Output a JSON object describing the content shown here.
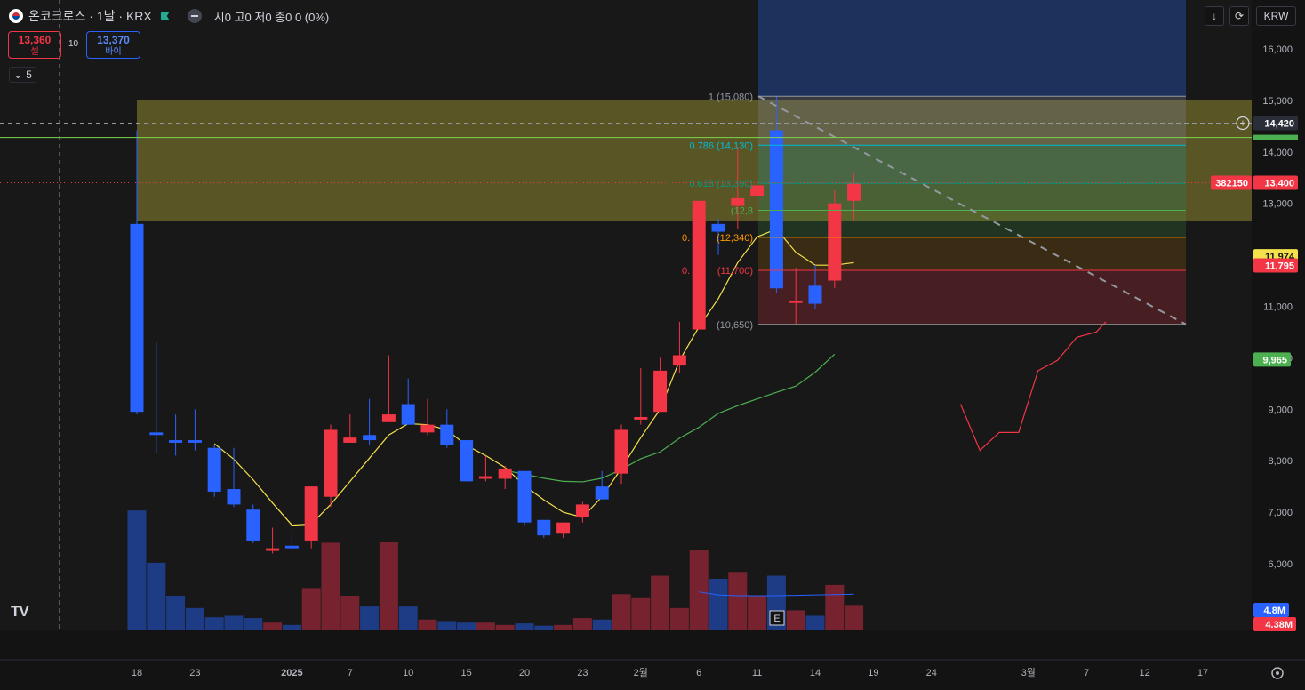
{
  "header": {
    "symbol_line": "온코크로스 · 1날 · KRX",
    "ohlc": "시0 고0 저0 종0 0 (0%)",
    "sell_price": "13,360",
    "sell_label": "셀",
    "buy_price": "13,370",
    "buy_label": "바이",
    "spread": "10",
    "interval_value": "5"
  },
  "toolbar": {
    "currency": "KRW",
    "download_icon": "arrow-down-icon",
    "refresh_icon": "refresh-icon"
  },
  "colors": {
    "up": "#f23645",
    "down": "#2962ff",
    "ma_fast": "#f5e14b",
    "ma_slow": "#4caf50",
    "zone": "#6f6a2a",
    "background": "#131313"
  },
  "chart_data": {
    "type": "candlestick",
    "y_range": [
      5200,
      17000
    ],
    "volume_range": [
      0,
      22000000
    ],
    "x_ticks": [
      "18",
      "23",
      "2025",
      "7",
      "10",
      "15",
      "20",
      "23",
      "2월",
      "6",
      "11",
      "14",
      "19",
      "24",
      "3월",
      "7",
      "12",
      "17"
    ],
    "y_ticks": [
      "16,000",
      "15,000",
      "14,000",
      "13,000",
      "12,000",
      "11,000",
      "10,000",
      "9,000",
      "8,000",
      "7,000",
      "6,000"
    ],
    "candles": [
      {
        "o": 12600,
        "h": 14420,
        "l": 8900,
        "c": 8950,
        "v": 15500000
      },
      {
        "o": 8550,
        "h": 10300,
        "l": 8150,
        "c": 8500,
        "v": 8700000
      },
      {
        "o": 8400,
        "h": 8900,
        "l": 8100,
        "c": 8350,
        "v": 4400000
      },
      {
        "o": 8400,
        "h": 9000,
        "l": 8200,
        "c": 8350,
        "v": 2800000
      },
      {
        "o": 8250,
        "h": 8300,
        "l": 7300,
        "c": 7400,
        "v": 1600000
      },
      {
        "o": 7450,
        "h": 8250,
        "l": 7100,
        "c": 7150,
        "v": 1800000
      },
      {
        "o": 7050,
        "h": 7150,
        "l": 6400,
        "c": 6450,
        "v": 1500000
      },
      {
        "o": 6250,
        "h": 6700,
        "l": 6200,
        "c": 6300,
        "v": 900000
      },
      {
        "o": 6350,
        "h": 6650,
        "l": 6250,
        "c": 6300,
        "v": 600000
      },
      {
        "o": 6450,
        "h": 7500,
        "l": 6300,
        "c": 7500,
        "v": 5400000
      },
      {
        "o": 7300,
        "h": 8700,
        "l": 7100,
        "c": 8600,
        "v": 11300000
      },
      {
        "o": 8350,
        "h": 8900,
        "l": 8350,
        "c": 8450,
        "v": 4400000
      },
      {
        "o": 8500,
        "h": 9200,
        "l": 8300,
        "c": 8400,
        "v": 3000000
      },
      {
        "o": 8750,
        "h": 10050,
        "l": 8750,
        "c": 8900,
        "v": 11400000
      },
      {
        "o": 9100,
        "h": 9600,
        "l": 8700,
        "c": 8700,
        "v": 3000000
      },
      {
        "o": 8550,
        "h": 9200,
        "l": 8500,
        "c": 8700,
        "v": 1300000
      },
      {
        "o": 8700,
        "h": 9000,
        "l": 8250,
        "c": 8300,
        "v": 1100000
      },
      {
        "o": 8400,
        "h": 8400,
        "l": 7600,
        "c": 7600,
        "v": 900000
      },
      {
        "o": 7650,
        "h": 8100,
        "l": 7600,
        "c": 7700,
        "v": 900000
      },
      {
        "o": 7650,
        "h": 7900,
        "l": 7450,
        "c": 7850,
        "v": 600000
      },
      {
        "o": 7800,
        "h": 7800,
        "l": 6750,
        "c": 6800,
        "v": 800000
      },
      {
        "o": 6850,
        "h": 6850,
        "l": 6500,
        "c": 6550,
        "v": 500000
      },
      {
        "o": 6600,
        "h": 6800,
        "l": 6500,
        "c": 6800,
        "v": 600000
      },
      {
        "o": 6900,
        "h": 7200,
        "l": 6800,
        "c": 7150,
        "v": 1500000
      },
      {
        "o": 7500,
        "h": 7800,
        "l": 7250,
        "c": 7250,
        "v": 1300000
      },
      {
        "o": 7750,
        "h": 8700,
        "l": 7550,
        "c": 8600,
        "v": 4600000
      },
      {
        "o": 8800,
        "h": 9800,
        "l": 8700,
        "c": 8850,
        "v": 4200000
      },
      {
        "o": 8950,
        "h": 10000,
        "l": 8950,
        "c": 9750,
        "v": 7000000
      },
      {
        "o": 9850,
        "h": 10700,
        "l": 9700,
        "c": 10050,
        "v": 2800000
      },
      {
        "o": 10550,
        "h": 13000,
        "l": 10550,
        "c": 13050,
        "v": 10400000
      },
      {
        "o": 12600,
        "h": 12700,
        "l": 12000,
        "c": 12450,
        "v": 6600000
      },
      {
        "o": 12950,
        "h": 14100,
        "l": 12500,
        "c": 13100,
        "v": 7500000
      },
      {
        "o": 13150,
        "h": 13400,
        "l": 12850,
        "c": 13350,
        "v": 4400000
      },
      {
        "o": 14420,
        "h": 15080,
        "l": 11250,
        "c": 11350,
        "v": 7000000
      },
      {
        "o": 11100,
        "h": 11750,
        "l": 10650,
        "c": 11100,
        "v": 2500000
      },
      {
        "o": 11400,
        "h": 11800,
        "l": 10950,
        "c": 11050,
        "v": 1800000
      },
      {
        "o": 11500,
        "h": 13250,
        "l": 11350,
        "c": 13000,
        "v": 5800000
      },
      {
        "o": 13050,
        "h": 13600,
        "l": 12650,
        "c": 13400,
        "v": 3200000
      }
    ],
    "ma_fast": [
      {
        "i": 4,
        "v": 8330
      },
      {
        "i": 5,
        "v": 8030
      },
      {
        "i": 6,
        "v": 7630
      },
      {
        "i": 7,
        "v": 7180
      },
      {
        "i": 8,
        "v": 6750
      },
      {
        "i": 9,
        "v": 6770
      },
      {
        "i": 10,
        "v": 7150
      },
      {
        "i": 11,
        "v": 7600
      },
      {
        "i": 12,
        "v": 8050
      },
      {
        "i": 13,
        "v": 8500
      },
      {
        "i": 14,
        "v": 8720
      },
      {
        "i": 15,
        "v": 8700
      },
      {
        "i": 16,
        "v": 8600
      },
      {
        "i": 17,
        "v": 8300
      },
      {
        "i": 18,
        "v": 8100
      },
      {
        "i": 19,
        "v": 7870
      },
      {
        "i": 20,
        "v": 7520
      },
      {
        "i": 21,
        "v": 7240
      },
      {
        "i": 22,
        "v": 7000
      },
      {
        "i": 23,
        "v": 6900
      },
      {
        "i": 24,
        "v": 7300
      },
      {
        "i": 25,
        "v": 7850
      },
      {
        "i": 26,
        "v": 8450
      },
      {
        "i": 27,
        "v": 9000
      },
      {
        "i": 28,
        "v": 9950
      },
      {
        "i": 29,
        "v": 10600
      },
      {
        "i": 30,
        "v": 11150
      },
      {
        "i": 31,
        "v": 11850
      },
      {
        "i": 32,
        "v": 12350
      },
      {
        "i": 33,
        "v": 12500
      },
      {
        "i": 34,
        "v": 12050
      },
      {
        "i": 35,
        "v": 11800
      },
      {
        "i": 36,
        "v": 11800
      },
      {
        "i": 37,
        "v": 11850
      }
    ],
    "ma_slow": [
      {
        "i": 19,
        "v": 7810
      },
      {
        "i": 20,
        "v": 7740
      },
      {
        "i": 21,
        "v": 7660
      },
      {
        "i": 22,
        "v": 7600
      },
      {
        "i": 23,
        "v": 7590
      },
      {
        "i": 24,
        "v": 7660
      },
      {
        "i": 25,
        "v": 7830
      },
      {
        "i": 26,
        "v": 8040
      },
      {
        "i": 27,
        "v": 8170
      },
      {
        "i": 28,
        "v": 8440
      },
      {
        "i": 29,
        "v": 8650
      },
      {
        "i": 30,
        "v": 8920
      },
      {
        "i": 31,
        "v": 9070
      },
      {
        "i": 32,
        "v": 9200
      },
      {
        "i": 33,
        "v": 9330
      },
      {
        "i": 34,
        "v": 9450
      },
      {
        "i": 35,
        "v": 9720
      },
      {
        "i": 36,
        "v": 10070
      }
    ],
    "volume_ma": [
      {
        "i": 29,
        "v": 4900000
      },
      {
        "i": 30,
        "v": 4500000
      },
      {
        "i": 31,
        "v": 4400000
      },
      {
        "i": 32,
        "v": 4400000
      },
      {
        "i": 33,
        "v": 4400000
      },
      {
        "i": 34,
        "v": 4450000
      },
      {
        "i": 35,
        "v": 4500000
      },
      {
        "i": 36,
        "v": 4550000
      },
      {
        "i": 37,
        "v": 4600000
      }
    ],
    "projection": [
      {
        "i": 42.5,
        "v": 9100
      },
      {
        "i": 43.5,
        "v": 8200
      },
      {
        "i": 44.5,
        "v": 8550
      },
      {
        "i": 45.5,
        "v": 8550
      },
      {
        "i": 46.5,
        "v": 9750
      },
      {
        "i": 47.5,
        "v": 9950
      },
      {
        "i": 48.5,
        "v": 10400
      },
      {
        "i": 49.5,
        "v": 10500
      },
      {
        "i": 50,
        "v": 10700
      }
    ],
    "fib_levels": [
      {
        "label": "1 (15,080)",
        "value": 15080,
        "color": "#9598a1"
      },
      {
        "label": "0.786 (14,130)",
        "value": 14130,
        "color": "#00bcd4"
      },
      {
        "label": "0.618 (13,390)",
        "value": 13390,
        "color": "#089981"
      },
      {
        "label": "(12,8",
        "value": 12865,
        "color": "#4caf50"
      },
      {
        "label": "0.",
        "value": 12340,
        "color": "#ff9800"
      },
      {
        "label": "(12,340)",
        "value": 12340,
        "color": "#ff9800"
      },
      {
        "label": "0.",
        "value": 11700,
        "color": "#f23645"
      },
      {
        "label": "(11,700)",
        "value": 11700,
        "color": "#f23645"
      },
      {
        "label": "(10,650)",
        "value": 10650,
        "color": "#9598a1"
      }
    ],
    "zone": {
      "top": 15000,
      "bottom": 12650
    },
    "last_price": 13400,
    "price_labels": {
      "crosshair": "14,420",
      "last_price": "13,400",
      "countdown": "382150",
      "ma_fast": "11,974",
      "fib": "11,795",
      "ma_slow": "9,965",
      "volume_up": "4.8M",
      "volume_down": "4.38M"
    },
    "earnings_marker": "E"
  }
}
